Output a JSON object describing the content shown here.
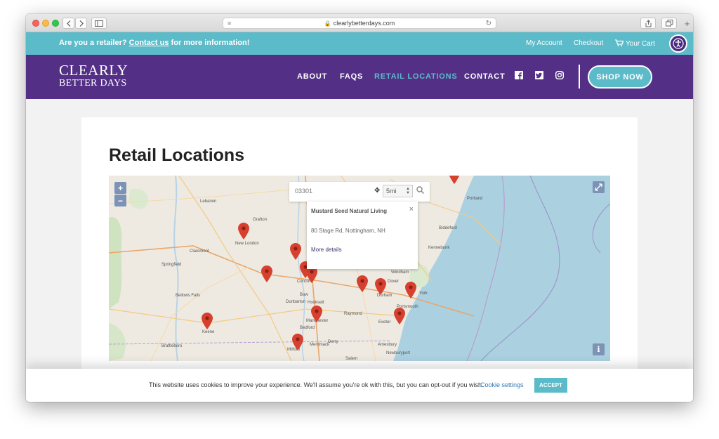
{
  "browser": {
    "url": "clearlybetterdays.com",
    "back_icon": "chevron-left-icon",
    "forward_icon": "chevron-right-icon"
  },
  "topbar": {
    "message_before": "Are you a retailer? ",
    "message_link": "Contact us",
    "message_after": " for more information!",
    "my_account": "My Account",
    "checkout": "Checkout",
    "cart": "Your Cart"
  },
  "nav": {
    "logo_line1": "CLEARLY",
    "logo_line2": "BETTER DAYS",
    "links": [
      {
        "label": "ABOUT",
        "active": false
      },
      {
        "label": "FAQS",
        "active": false
      },
      {
        "label": "RETAIL LOCATIONS",
        "active": true
      },
      {
        "label": "CONTACT",
        "active": false
      }
    ],
    "shop_now": "SHOP NOW"
  },
  "page": {
    "title": "Retail Locations"
  },
  "map": {
    "zoom_in": "+",
    "zoom_out": "−",
    "search_placeholder": "03301",
    "radius": "5mi",
    "popup": {
      "title": "Mustard Seed Natural Living",
      "address": "80 Stage Rd, Nottingham, NH",
      "more": "More details",
      "close": "×"
    },
    "towns": [
      "Lebanon",
      "New London",
      "Grafton",
      "Claremont",
      "Springfield",
      "Bellows Falls",
      "Keene",
      "Brattleboro",
      "Concord",
      "Bow",
      "Dunbarton",
      "Hooksett",
      "Manchester",
      "Bedford",
      "Merrimack",
      "Milford",
      "Derry",
      "Raymond",
      "Exeter",
      "Salem",
      "Portsmouth",
      "Dover",
      "Durham",
      "Portland",
      "Biddeford",
      "Kennebunk",
      "Amesbury",
      "Newburyport",
      "York",
      "Windham"
    ]
  },
  "cookie": {
    "text": "This website uses cookies to improve your experience. We'll assume you're ok with this, but you can opt-out if you wish.",
    "settings": "Cookie settings",
    "accept": "ACCEPT"
  }
}
